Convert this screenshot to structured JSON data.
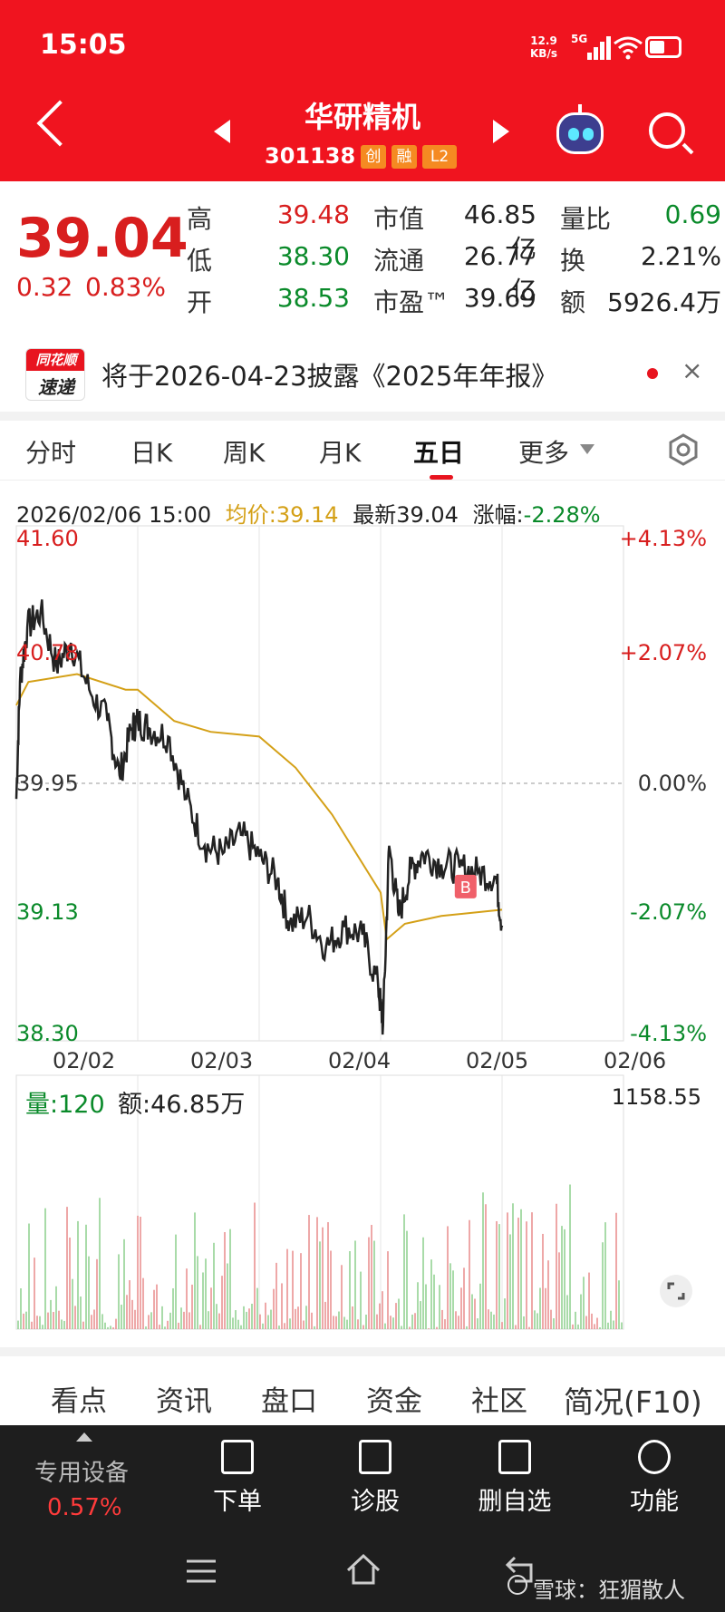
{
  "status_bar": {
    "time": "15:05",
    "speed_value": "12.9",
    "speed_unit": "KB/s",
    "network": "5G",
    "battery": "battery"
  },
  "header": {
    "title": "华研精机",
    "code": "301138",
    "tags": [
      "创",
      "融",
      "L2"
    ]
  },
  "quote": {
    "price": "39.04",
    "change": "0.32",
    "change_pct": "0.83%",
    "rows": [
      {
        "l1": "高",
        "v1": "39.48",
        "l2": "市值",
        "v2": "46.85亿",
        "l3": "量比",
        "v3": "0.69"
      },
      {
        "l1": "低",
        "v1": "38.30",
        "l2": "流通",
        "v2": "26.77亿",
        "l3": "换",
        "v3": "2.21%"
      },
      {
        "l1": "开",
        "v1": "38.53",
        "l2": "市盈™",
        "v2": "39.69",
        "l3": "额",
        "v3": "5926.4万"
      }
    ]
  },
  "notice": {
    "logo_top": "同花顺",
    "logo_bottom": "速递",
    "text": "将于2026-04-23披露《2025年年报》",
    "close": "×"
  },
  "kline_tabs": [
    "分时",
    "日K",
    "周K",
    "月K",
    "五日",
    "更多"
  ],
  "active_tab": 4,
  "chart_info": {
    "datetime": "2026/02/06 15:00",
    "avg_label": "均价:39.14",
    "latest_label": "最新39.04",
    "change_label": "涨幅:",
    "change_value": "-2.28%"
  },
  "chart_data": {
    "type": "line",
    "x": [
      "02/02",
      "02/03",
      "02/04",
      "02/05",
      "02/06"
    ],
    "y_ticks_left": [
      "41.60",
      "40.78",
      "39.95",
      "39.13",
      "38.30"
    ],
    "y_ticks_right": [
      "+4.13%",
      "+2.07%",
      "0.00%",
      "-2.07%",
      "-4.13%"
    ],
    "ylim": [
      38.3,
      41.6
    ],
    "series": [
      {
        "values": [
          [
            0,
            39.85
          ],
          [
            0.03,
            40.6
          ],
          [
            0.09,
            40.95
          ],
          [
            0.2,
            41.05
          ],
          [
            0.33,
            40.7
          ],
          [
            0.45,
            40.85
          ],
          [
            0.6,
            40.55
          ],
          [
            0.75,
            40.35
          ],
          [
            0.85,
            40.0
          ],
          [
            0.95,
            40.3
          ],
          [
            1.0,
            40.35
          ],
          [
            1.1,
            40.3
          ],
          [
            1.25,
            40.25
          ],
          [
            1.4,
            39.85
          ],
          [
            1.55,
            39.55
          ],
          [
            1.7,
            39.5
          ],
          [
            1.85,
            39.62
          ],
          [
            2.0,
            39.48
          ],
          [
            2.15,
            39.33
          ],
          [
            2.25,
            39.05
          ],
          [
            2.4,
            39.1
          ],
          [
            2.55,
            38.9
          ],
          [
            2.7,
            39.03
          ],
          [
            2.85,
            38.98
          ],
          [
            2.98,
            38.65
          ],
          [
            3.02,
            38.4
          ],
          [
            3.07,
            39.55
          ],
          [
            3.15,
            39.1
          ],
          [
            3.25,
            39.4
          ],
          [
            3.35,
            39.5
          ],
          [
            3.5,
            39.43
          ],
          [
            3.65,
            39.41
          ],
          [
            3.8,
            39.38
          ],
          [
            3.95,
            39.35
          ],
          [
            4.0,
            39.04
          ]
        ]
      },
      {
        "values": [
          [
            0,
            40.45
          ],
          [
            0.1,
            40.6
          ],
          [
            0.5,
            40.65
          ],
          [
            0.9,
            40.55
          ],
          [
            1.0,
            40.55
          ],
          [
            1.3,
            40.35
          ],
          [
            1.6,
            40.28
          ],
          [
            2.0,
            40.25
          ],
          [
            2.3,
            40.05
          ],
          [
            2.6,
            39.75
          ],
          [
            3.0,
            39.25
          ],
          [
            3.05,
            38.95
          ],
          [
            3.2,
            39.05
          ],
          [
            3.5,
            39.1
          ],
          [
            4.0,
            39.14
          ]
        ]
      }
    ],
    "marker": "B",
    "volume": {
      "label": "量:120",
      "amount": "额:46.85万",
      "max": "1158.55"
    }
  },
  "bottom_tabs": [
    "看点",
    "资讯",
    "盘口",
    "资金",
    "社区",
    "简况(F10)"
  ],
  "toolbar": {
    "device_label": "专用设备",
    "device_value": "0.57%",
    "items": [
      "下单",
      "诊股",
      "删自选",
      "功能"
    ]
  },
  "watermark": "雪球：狂猸散人",
  "colors": {
    "header": "#f0141f",
    "up": "#d81e1e",
    "down": "#0a8a2a",
    "avg": "#d4a017"
  }
}
